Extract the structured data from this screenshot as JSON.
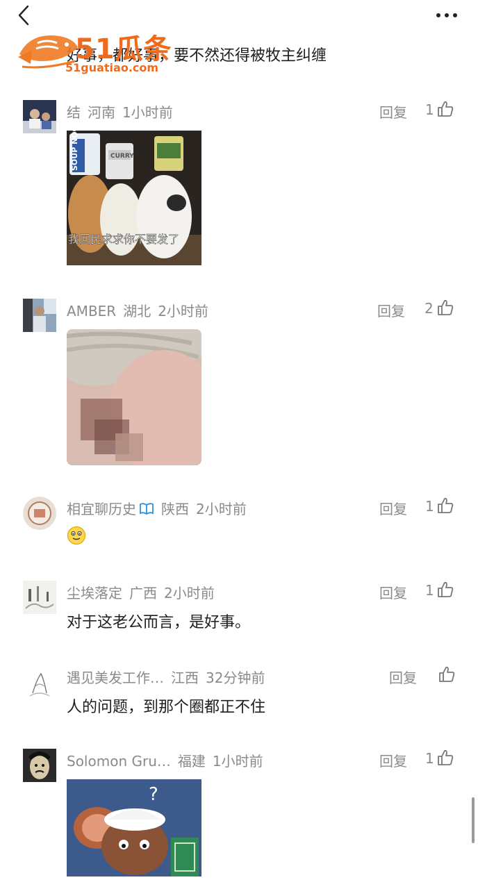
{
  "header": {
    "back_icon": "chevron-left-icon",
    "more_icon": "ellipsis-icon"
  },
  "watermark": {
    "brand": "51瓜条",
    "domain": "51guatiao.com"
  },
  "previous_comment": {
    "text": "好事，都好事，要不然还得被牧主纠缠"
  },
  "comments": [
    {
      "user": "结",
      "region": "河南",
      "time": "1小时前",
      "reply": "回复",
      "likes": "1",
      "image_caption": "我回民求求你不要发了",
      "image_cup_labels": [
        "SOUP NOODLE",
        "CURRY",
        ""
      ]
    },
    {
      "user": "AMBER",
      "region": "湖北",
      "time": "2小时前",
      "reply": "回复",
      "likes": "2"
    },
    {
      "user": "相宜聊历史",
      "region": "陕西",
      "time": "2小时前",
      "reply": "回复",
      "likes": "1",
      "text_emoji": "smile-emoji"
    },
    {
      "user": "尘埃落定",
      "region": "广西",
      "time": "2小时前",
      "reply": "回复",
      "likes": "1",
      "text": "对于这老公而言，是好事。"
    },
    {
      "user": "遇见美发工作…",
      "region": "江西",
      "time": "32分钟前",
      "reply": "回复",
      "likes": "",
      "text": "人的问题，到那个圈都正不住"
    },
    {
      "user": "Solomon Gru…",
      "region": "福建",
      "time": "1小时前",
      "reply": "回复",
      "likes": "1",
      "image_symbol": "?"
    }
  ],
  "colors": {
    "meta_gray": "#8a8a8a",
    "text": "#1e1e1e",
    "brand_orange": "#f06a1b",
    "verified_blue": "#2e8fd6"
  }
}
